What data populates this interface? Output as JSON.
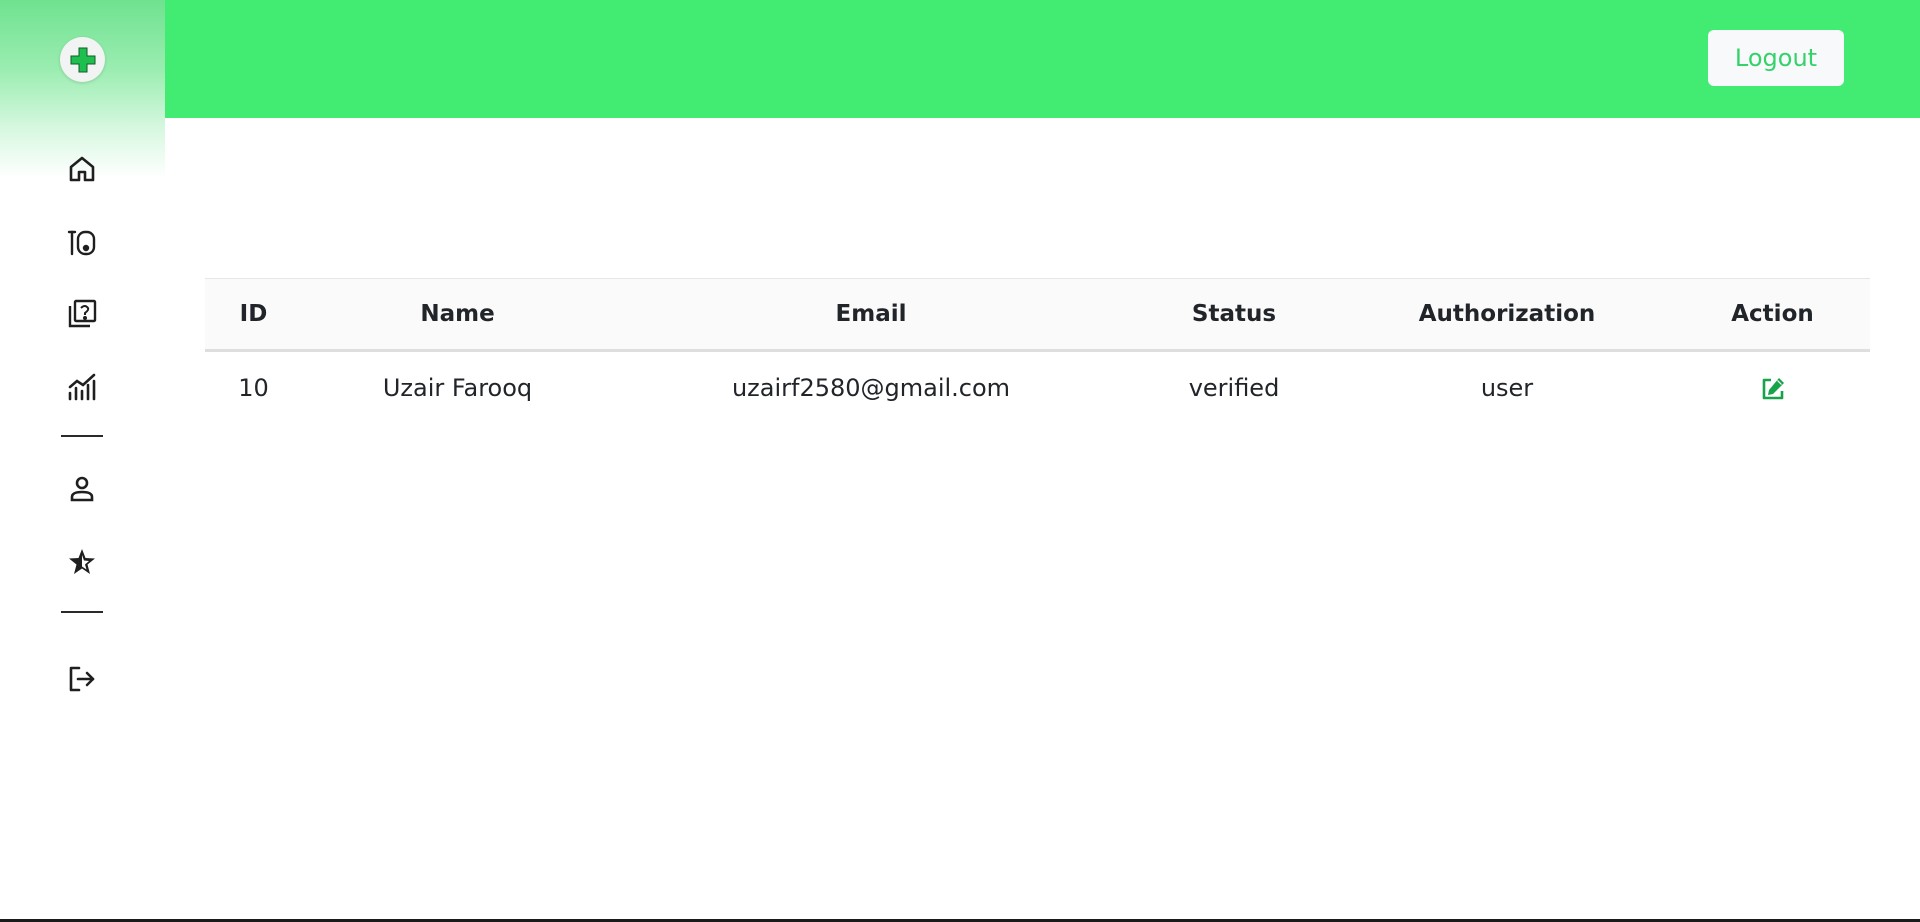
{
  "header": {
    "logout_label": "Logout"
  },
  "sidebar": {
    "items": [
      {
        "name": "home",
        "icon": "home-icon"
      },
      {
        "name": "medicines",
        "icon": "medicine-icon"
      },
      {
        "name": "questions",
        "icon": "question-icon"
      },
      {
        "name": "analytics",
        "icon": "chart-icon"
      },
      {
        "name": "profile",
        "icon": "user-icon"
      },
      {
        "name": "favorites",
        "icon": "star-icon"
      },
      {
        "name": "logout",
        "icon": "sign-out-icon"
      }
    ]
  },
  "table": {
    "columns": [
      "ID",
      "Name",
      "Email",
      "Status",
      "Authorization",
      "Action"
    ],
    "rows": [
      {
        "id": "10",
        "name": "Uzair Farooq",
        "email": "uzairf2580@gmail.com",
        "status": "verified",
        "authorization": "user",
        "action_icon": "edit-icon"
      }
    ]
  },
  "colors": {
    "topbar": "#42ec73",
    "accent": "#35d26c",
    "logo_cross": "#1fbf4f",
    "edit_icon": "#16a34a"
  }
}
